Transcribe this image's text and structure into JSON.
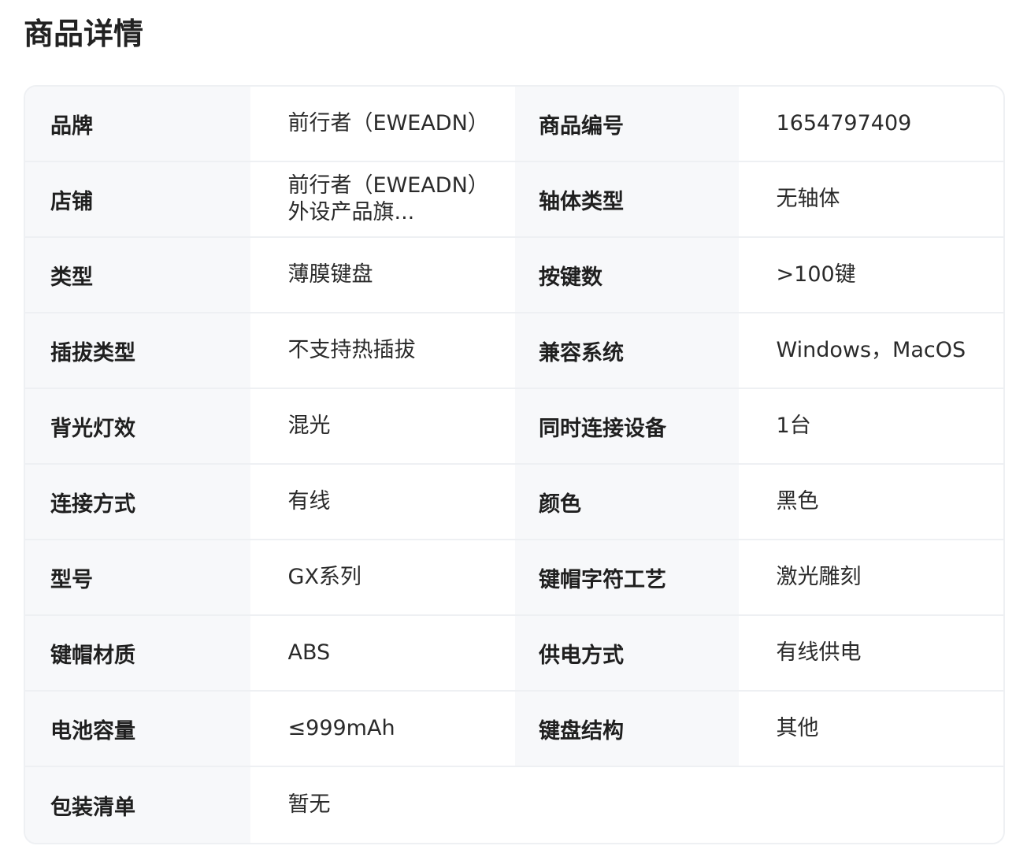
{
  "page": {
    "title": "商品详情"
  },
  "specs": [
    {
      "label1": "品牌",
      "value1": "前行者（EWEADN）",
      "label2": "商品编号",
      "value2": "1654797409"
    },
    {
      "label1": "店铺",
      "value1": "前行者（EWEADN）外设产品旗...",
      "label2": "轴体类型",
      "value2": "无轴体"
    },
    {
      "label1": "类型",
      "value1": "薄膜键盘",
      "label2": "按键数",
      "value2": ">100键"
    },
    {
      "label1": "插拔类型",
      "value1": "不支持热插拔",
      "label2": "兼容系统",
      "value2": "Windows，MacOS"
    },
    {
      "label1": "背光灯效",
      "value1": "混光",
      "label2": "同时连接设备",
      "value2": "1台"
    },
    {
      "label1": "连接方式",
      "value1": "有线",
      "label2": "颜色",
      "value2": "黑色"
    },
    {
      "label1": "型号",
      "value1": "GX系列",
      "label2": "键帽字符工艺",
      "value2": "激光雕刻"
    },
    {
      "label1": "键帽材质",
      "value1": "ABS",
      "label2": "供电方式",
      "value2": "有线供电"
    },
    {
      "label1": "电池容量",
      "value1": "≤999mAh",
      "label2": "键盘结构",
      "value2": "其他"
    }
  ],
  "last_row": {
    "label": "包装清单",
    "value": "暂无"
  }
}
